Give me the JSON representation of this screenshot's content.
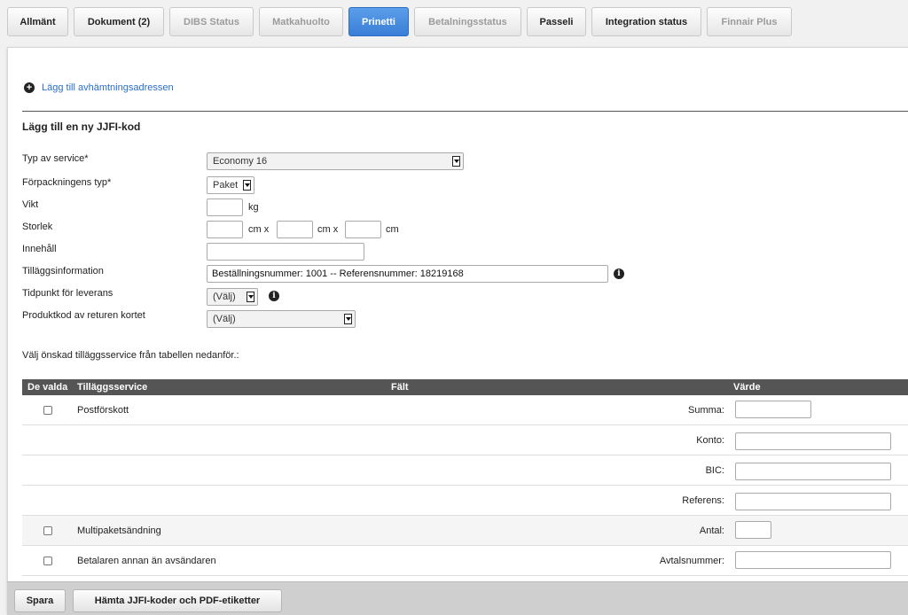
{
  "tabs": [
    {
      "label": "Allmänt",
      "state": "normal"
    },
    {
      "label": "Dokument (2)",
      "state": "normal"
    },
    {
      "label": "DIBS Status",
      "state": "disabled"
    },
    {
      "label": "Matkahuolto",
      "state": "disabled"
    },
    {
      "label": "Prinetti",
      "state": "active"
    },
    {
      "label": "Betalningsstatus",
      "state": "disabled"
    },
    {
      "label": "Passeli",
      "state": "normal"
    },
    {
      "label": "Integration status",
      "state": "normal"
    },
    {
      "label": "Finnair Plus",
      "state": "disabled"
    }
  ],
  "add_pickup_link": "Lägg till avhämtningsadressen",
  "section_title": "Lägg till en ny JJFI-kod",
  "form": {
    "service_type": {
      "label": "Typ av service*",
      "value": "Economy 16"
    },
    "package_type": {
      "label": "Förpackningens typ*",
      "value": "Paket"
    },
    "weight": {
      "label": "Vikt",
      "unit": "kg",
      "value": ""
    },
    "size": {
      "label": "Storlek",
      "unit_cm_x": "cm x",
      "unit_cm": "cm"
    },
    "content": {
      "label": "Innehåll",
      "value": ""
    },
    "additional_info": {
      "label": "Tilläggsinformation",
      "value": "Beställningsnummer: 1001 -- Referensnummer: 18219168"
    },
    "delivery_time": {
      "label": "Tidpunkt för leverans",
      "value": "(Välj)"
    },
    "return_product_code": {
      "label": "Produktkod av returen kortet",
      "value": "(Välj)"
    }
  },
  "hint": "Välj önskad tilläggsservice från tabellen nedanför.:",
  "table": {
    "headers": {
      "selected": "De valda",
      "service": "Tilläggsservice",
      "field": "Fält",
      "value": "Värde"
    },
    "rows": [
      {
        "service": "Postförskott",
        "field": "Summa:",
        "checkbox": true
      },
      {
        "service": "",
        "field": "Konto:",
        "checkbox": false
      },
      {
        "service": "",
        "field": "BIC:",
        "checkbox": false
      },
      {
        "service": "",
        "field": "Referens:",
        "checkbox": false
      },
      {
        "service": "Multipaketsändning",
        "field": "Antal:",
        "checkbox": true
      },
      {
        "service": "Betalaren annan än avsändaren",
        "field": "Avtalsnummer:",
        "checkbox": true
      }
    ]
  },
  "footer": {
    "save": "Spara",
    "fetch": "Hämta JJFI-koder och PDF-etiketter"
  }
}
